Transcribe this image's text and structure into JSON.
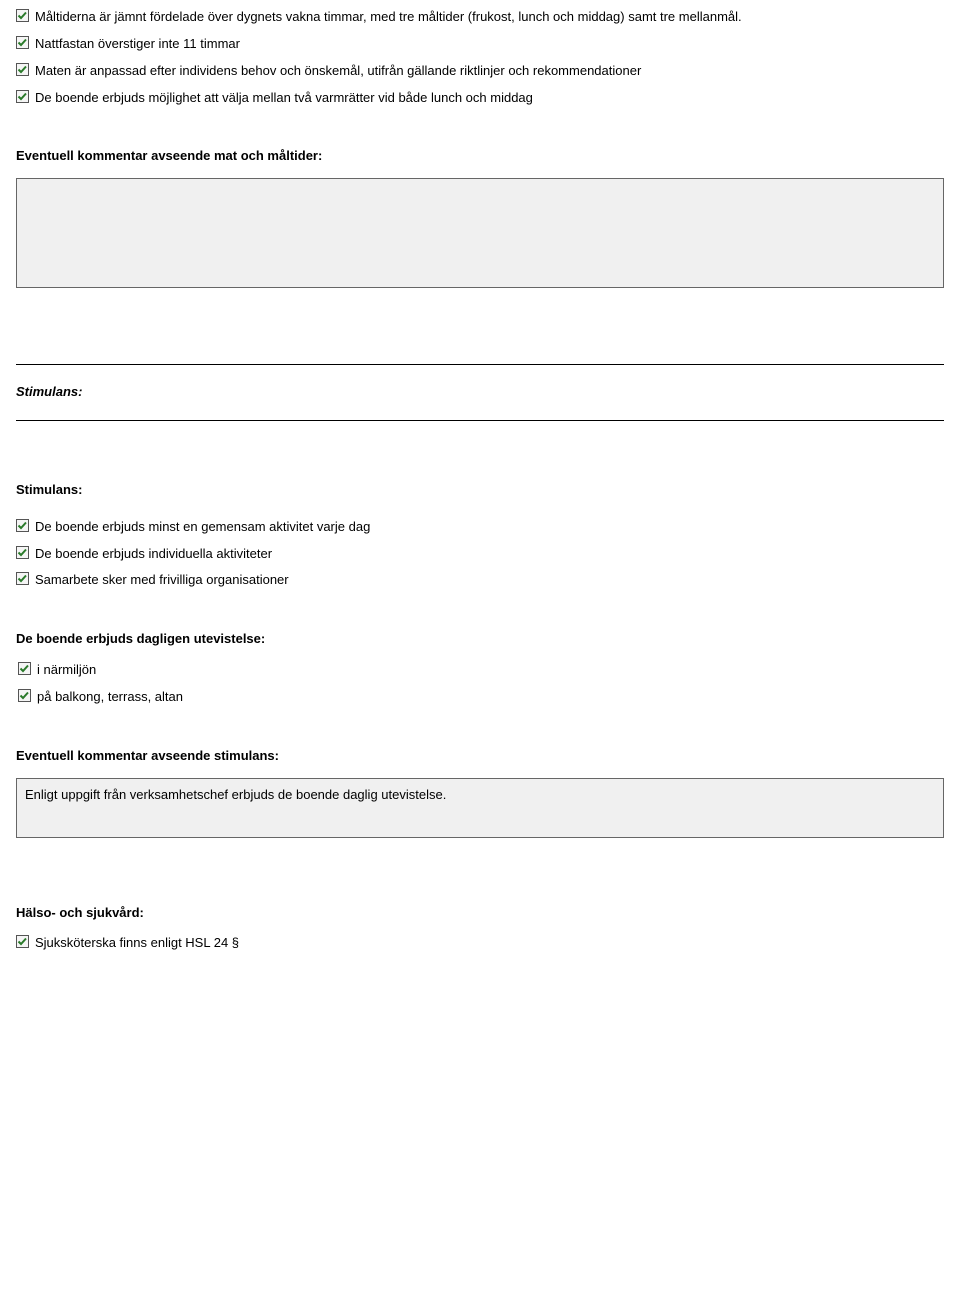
{
  "icons": {
    "checkbox_checked": "checkbox-checked-icon"
  },
  "mat": {
    "items": [
      "Måltiderna är jämnt fördelade över dygnets vakna timmar, med tre måltider (frukost, lunch och middag) samt tre mellanmål.",
      "Nattfastan överstiger inte 11 timmar",
      "Maten är anpassad efter individens behov och önskemål, utifrån gällande riktlinjer och rekommendationer",
      "De boende erbjuds möjlighet att välja mellan två varmrätter vid både lunch och middag"
    ]
  },
  "comment_mat": {
    "heading": "Eventuell kommentar avseende mat och måltider:",
    "value": ""
  },
  "stimulans": {
    "section_title": "Stimulans:",
    "sub_title": "Stimulans:",
    "items": [
      "De boende erbjuds minst en gemensam aktivitet varje dag",
      "De boende erbjuds individuella aktiviteter",
      "Samarbete sker med frivilliga organisationer"
    ]
  },
  "utevistelse": {
    "heading": "De boende erbjuds dagligen utevistelse:",
    "items": [
      "i närmiljön",
      "på balkong, terrass, altan"
    ]
  },
  "comment_stimulans": {
    "heading": "Eventuell kommentar avseende stimulans:",
    "value": "Enligt uppgift från verksamhetschef erbjuds de boende daglig utevistelse."
  },
  "hsl": {
    "heading": "Hälso- och sjukvård:",
    "items": [
      "Sjuksköterska finns enligt HSL 24 §"
    ]
  }
}
